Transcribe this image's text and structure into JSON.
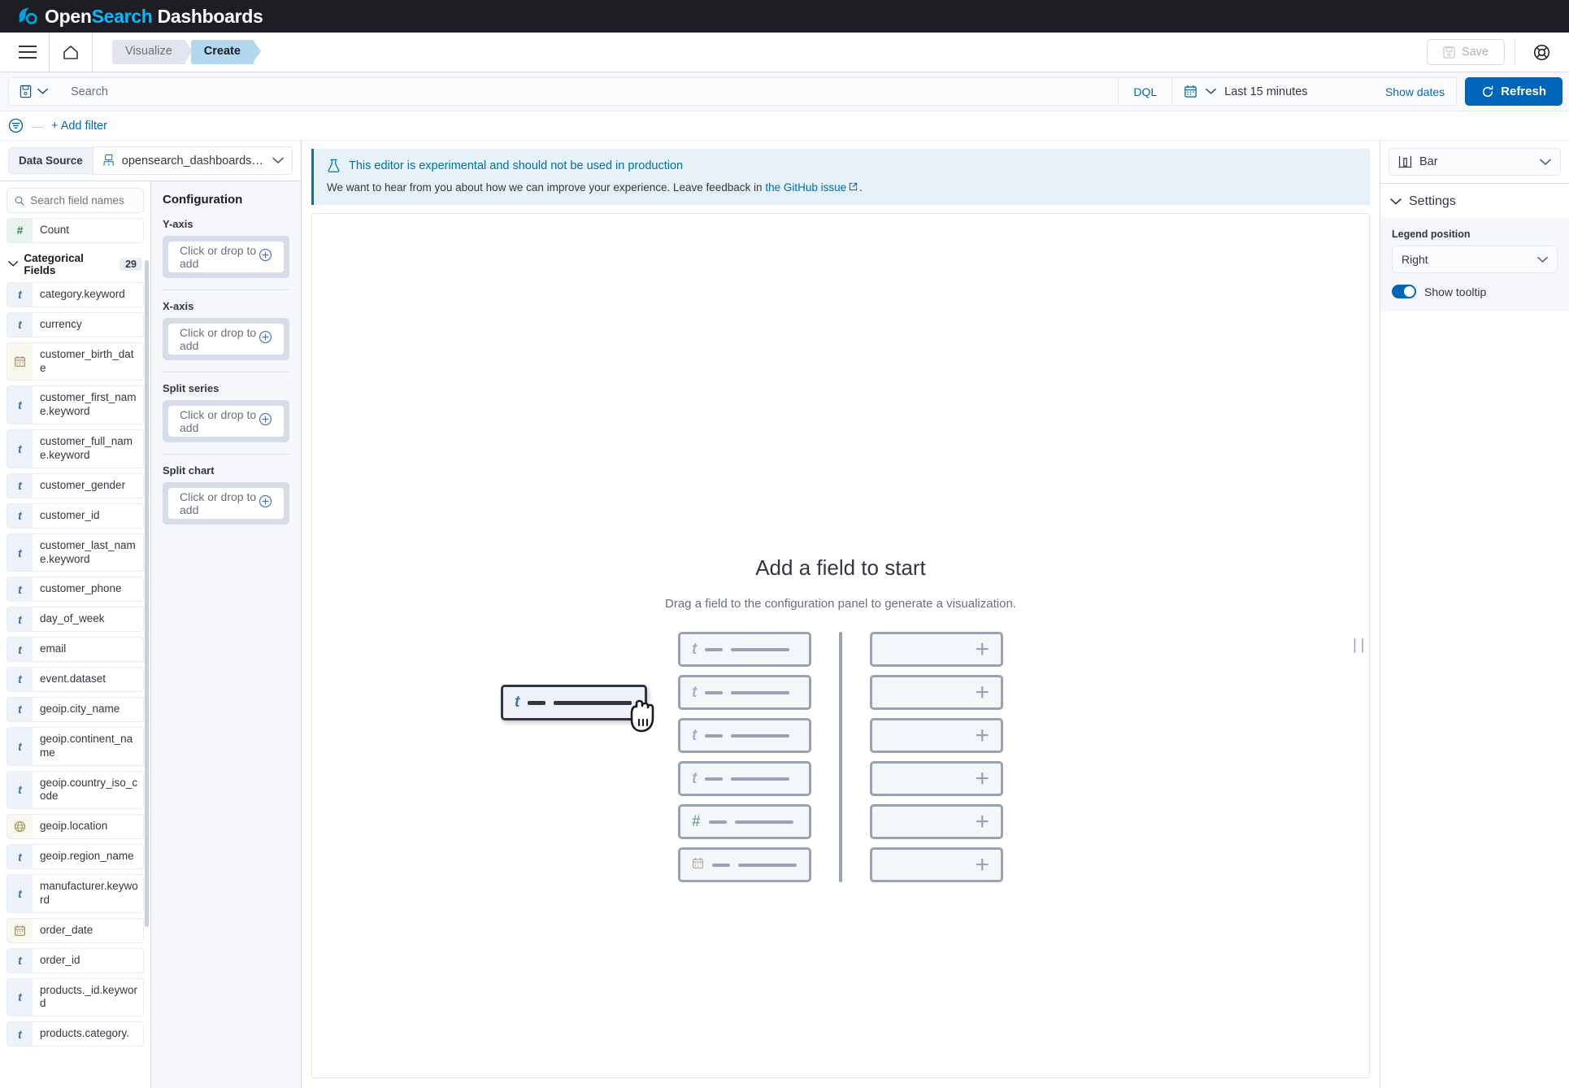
{
  "app": {
    "logo_open": "Open",
    "logo_search": "Search",
    "logo_dashboards": " Dashboards"
  },
  "nav": {
    "menu_icon": "hamburger-menu-icon",
    "home_icon": "home-icon",
    "breadcrumbs": [
      {
        "label": "Visualize",
        "active": false
      },
      {
        "label": "Create",
        "active": true
      }
    ],
    "save_label": "Save",
    "save_icon": "floppy-disk-icon",
    "help_icon": "help-lifebuoy-icon"
  },
  "query_bar": {
    "saved_query_icon": "saved-query-icon",
    "search_placeholder": "Search",
    "search_value": "",
    "language": "DQL",
    "calendar_icon": "calendar-icon",
    "date_range": "Last 15 minutes",
    "show_dates": "Show dates",
    "refresh_label": "Refresh",
    "refresh_icon": "refresh-icon"
  },
  "filter_bar": {
    "filter_icon": "filter-icon",
    "dash": "—",
    "add_filter": "+ Add filter"
  },
  "data_source": {
    "label": "Data Source",
    "icon": "index-pattern-icon",
    "value": "opensearch_dashboards_sample_data_ec...",
    "chevron": "chevron-down-icon"
  },
  "field_panel": {
    "search_placeholder": "Search field names",
    "search_value": "",
    "search_icon": "search-icon",
    "count_field": {
      "name": "Count",
      "type": "number",
      "glyph": "#"
    },
    "category_header": {
      "label": "Categorical Fields",
      "count": "29",
      "chevron": "chevron-down-icon"
    },
    "fields": [
      {
        "name": "category.keyword",
        "type": "text",
        "glyph": "t"
      },
      {
        "name": "currency",
        "type": "text",
        "glyph": "t"
      },
      {
        "name": "customer_birth_date",
        "type": "date",
        "glyph": "calendar"
      },
      {
        "name": "customer_first_name.keyword",
        "type": "text",
        "glyph": "t"
      },
      {
        "name": "customer_full_name.keyword",
        "type": "text",
        "glyph": "t"
      },
      {
        "name": "customer_gender",
        "type": "text",
        "glyph": "t"
      },
      {
        "name": "customer_id",
        "type": "text",
        "glyph": "t"
      },
      {
        "name": "customer_last_name.keyword",
        "type": "text",
        "glyph": "t"
      },
      {
        "name": "customer_phone",
        "type": "text",
        "glyph": "t"
      },
      {
        "name": "day_of_week",
        "type": "text",
        "glyph": "t"
      },
      {
        "name": "email",
        "type": "text",
        "glyph": "t"
      },
      {
        "name": "event.dataset",
        "type": "text",
        "glyph": "t"
      },
      {
        "name": "geoip.city_name",
        "type": "text",
        "glyph": "t"
      },
      {
        "name": "geoip.continent_name",
        "type": "text",
        "glyph": "t"
      },
      {
        "name": "geoip.country_iso_code",
        "type": "text",
        "glyph": "t"
      },
      {
        "name": "geoip.location",
        "type": "geo",
        "glyph": "globe"
      },
      {
        "name": "geoip.region_name",
        "type": "text",
        "glyph": "t"
      },
      {
        "name": "manufacturer.keyword",
        "type": "text",
        "glyph": "t"
      },
      {
        "name": "order_date",
        "type": "date",
        "glyph": "calendar"
      },
      {
        "name": "order_id",
        "type": "text",
        "glyph": "t"
      },
      {
        "name": "products._id.keyword",
        "type": "text",
        "glyph": "t"
      },
      {
        "name": "products.category.",
        "type": "text",
        "glyph": "t"
      }
    ]
  },
  "configuration": {
    "title": "Configuration",
    "dropzone_text": "Click or drop to add",
    "plus_icon": "circle-plus-icon",
    "groups": [
      {
        "label": "Y-axis"
      },
      {
        "label": "X-axis"
      },
      {
        "label": "Split series"
      },
      {
        "label": "Split chart"
      }
    ]
  },
  "callout": {
    "icon": "beaker-experimental-icon",
    "title": "This editor is experimental and should not be used in production",
    "body_before": "We want to hear from you about how we can improve your experience. Leave feedback in ",
    "link_text": "the GitHub issue",
    "external_icon": "external-link-icon",
    "body_after": "."
  },
  "empty_state": {
    "title": "Add a field to start",
    "subtitle": "Drag a field to the configuration panel to generate a visualization.",
    "left_bars": [
      {
        "glyph": "t",
        "type": "text"
      },
      {
        "glyph": "t",
        "type": "text"
      },
      {
        "glyph": "t",
        "type": "text"
      },
      {
        "glyph": "t",
        "type": "text"
      },
      {
        "glyph": "#",
        "type": "number"
      },
      {
        "glyph": "calendar",
        "type": "date"
      }
    ],
    "right_bars": [
      {
        "glyph": "+"
      },
      {
        "glyph": "+"
      },
      {
        "glyph": "+"
      },
      {
        "glyph": "+"
      },
      {
        "glyph": "+"
      },
      {
        "glyph": "+"
      }
    ],
    "drag_chip": {
      "glyph": "t",
      "cursor": "grabbing-hand-cursor"
    }
  },
  "right_panel": {
    "chart_type": "Bar",
    "chart_type_icon": "bar-chart-icon",
    "chevron": "chevron-down-icon",
    "settings_title": "Settings",
    "legend_position_label": "Legend position",
    "legend_position_value": "Right",
    "show_tooltip_label": "Show tooltip",
    "show_tooltip_enabled": true
  },
  "colors": {
    "topbar": "#1d1e24",
    "accent_blue": "#0065b8",
    "link_blue": "#006bb4",
    "logo_cyan": "#00bfff",
    "crumb_active": "#b3d7ef"
  }
}
